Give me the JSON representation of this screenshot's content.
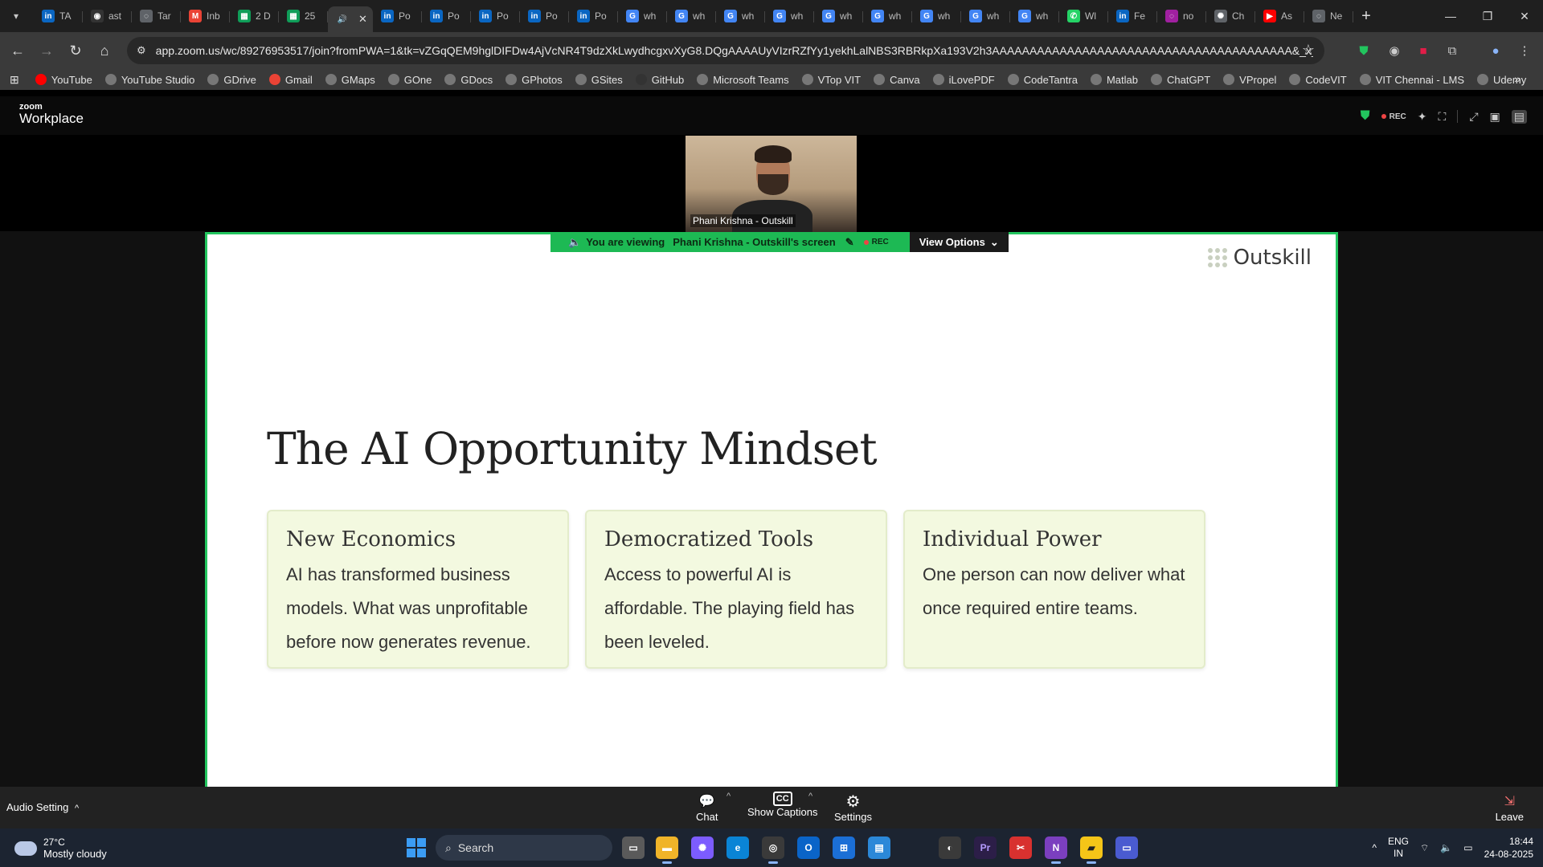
{
  "browser": {
    "tabs": [
      {
        "label": "TA",
        "favicon": "linkedin",
        "color": "#0a66c2"
      },
      {
        "label": "ast",
        "favicon": "github",
        "color": "#333333"
      },
      {
        "label": "Tar",
        "favicon": "generic",
        "color": "#5f6368"
      },
      {
        "label": "Inb",
        "favicon": "gmail",
        "color": "#ea4335"
      },
      {
        "label": "2 D",
        "favicon": "sheets",
        "color": "#0f9d58"
      },
      {
        "label": "25",
        "favicon": "sheets",
        "color": "#0f9d58"
      },
      {
        "label": "",
        "favicon": "audio",
        "color": "#3a3a3a",
        "active": true
      },
      {
        "label": "Po",
        "favicon": "linkedin",
        "color": "#0a66c2"
      },
      {
        "label": "Po",
        "favicon": "linkedin",
        "color": "#0a66c2"
      },
      {
        "label": "Po",
        "favicon": "linkedin",
        "color": "#0a66c2"
      },
      {
        "label": "Po",
        "favicon": "linkedin",
        "color": "#0a66c2"
      },
      {
        "label": "Po",
        "favicon": "linkedin",
        "color": "#0a66c2"
      },
      {
        "label": "wh",
        "favicon": "google",
        "color": "#4285f4"
      },
      {
        "label": "wh",
        "favicon": "google",
        "color": "#4285f4"
      },
      {
        "label": "wh",
        "favicon": "google",
        "color": "#4285f4"
      },
      {
        "label": "wh",
        "favicon": "google",
        "color": "#4285f4"
      },
      {
        "label": "wh",
        "favicon": "google",
        "color": "#4285f4"
      },
      {
        "label": "wh",
        "favicon": "google",
        "color": "#4285f4"
      },
      {
        "label": "wh",
        "favicon": "google",
        "color": "#4285f4"
      },
      {
        "label": "wh",
        "favicon": "google",
        "color": "#4285f4"
      },
      {
        "label": "wh",
        "favicon": "google",
        "color": "#4285f4"
      },
      {
        "label": "Wl",
        "favicon": "whatsapp",
        "color": "#25d366"
      },
      {
        "label": "Fe",
        "favicon": "linkedin",
        "color": "#0a66c2"
      },
      {
        "label": "no",
        "favicon": "generic",
        "color": "#a020a0"
      },
      {
        "label": "Ch",
        "favicon": "chatgpt",
        "color": "#5f6368"
      },
      {
        "label": "As",
        "favicon": "youtube",
        "color": "#ff0000"
      },
      {
        "label": "Ne",
        "favicon": "generic",
        "color": "#5f6368"
      }
    ],
    "url": "app.zoom.us/wc/89276953517/join?fromPWA=1&tk=vZGqQEM9hglDIFDw4AjVcNR4T9dzXkLwydhcgxvXyG8.DQgAAAAUyVIzrRZfYy1yekhLalNBS3RBRkpXa193V2h3AAAAAAAAAAAAAAAAAAAAAAAAAAAAAAAAAAAAAAAA&_x_zm_r...",
    "bookmarks": [
      {
        "label": "YouTube",
        "color": "#ff0000"
      },
      {
        "label": "YouTube Studio",
        "color": "#777777"
      },
      {
        "label": "GDrive",
        "color": "#777777"
      },
      {
        "label": "Gmail",
        "color": "#ea4335"
      },
      {
        "label": "GMaps",
        "color": "#777777"
      },
      {
        "label": "GOne",
        "color": "#777777"
      },
      {
        "label": "GDocs",
        "color": "#777777"
      },
      {
        "label": "GPhotos",
        "color": "#777777"
      },
      {
        "label": "GSites",
        "color": "#777777"
      },
      {
        "label": "GitHub",
        "color": "#333333"
      },
      {
        "label": "Microsoft Teams",
        "color": "#777777"
      },
      {
        "label": "VTop VIT",
        "color": "#777777"
      },
      {
        "label": "Canva",
        "color": "#777777"
      },
      {
        "label": "iLovePDF",
        "color": "#777777"
      },
      {
        "label": "CodeTantra",
        "color": "#777777"
      },
      {
        "label": "Matlab",
        "color": "#777777"
      },
      {
        "label": "ChatGPT",
        "color": "#777777"
      },
      {
        "label": "VPropel",
        "color": "#777777"
      },
      {
        "label": "CodeVIT",
        "color": "#777777"
      },
      {
        "label": "VIT Chennai - LMS",
        "color": "#777777"
      },
      {
        "label": "Udemy",
        "color": "#777777"
      }
    ]
  },
  "zoom": {
    "logo_small": "zoom",
    "logo_large": "Workplace",
    "rec_label": "REC",
    "participant_name": "Phani Krishna - Outskill",
    "viewing_prefix": "You are viewing",
    "viewing_name": "Phani Krishna - Outskill's screen",
    "viewing_rec": "REC",
    "view_options": "View Options",
    "toolbar": {
      "audio_setting": "Audio Setting",
      "chat": "Chat",
      "captions": "Show Captions",
      "settings": "Settings",
      "leave": "Leave"
    }
  },
  "slide": {
    "brand": "Outskill",
    "title": "The AI Opportunity Mindset",
    "cards": [
      {
        "title": "New Economics",
        "body": "AI has transformed business models. What was unprofitable before now generates revenue."
      },
      {
        "title": "Democratized Tools",
        "body": "Access to powerful AI is affordable. The playing field has been leveled."
      },
      {
        "title": "Individual Power",
        "body": "One person can now deliver what once required entire teams."
      }
    ]
  },
  "taskbar": {
    "temperature": "27°C",
    "weather": "Mostly cloudy",
    "search": "Search",
    "lang": "ENG",
    "region": "IN",
    "time": "18:44",
    "date": "24-08-2025"
  }
}
